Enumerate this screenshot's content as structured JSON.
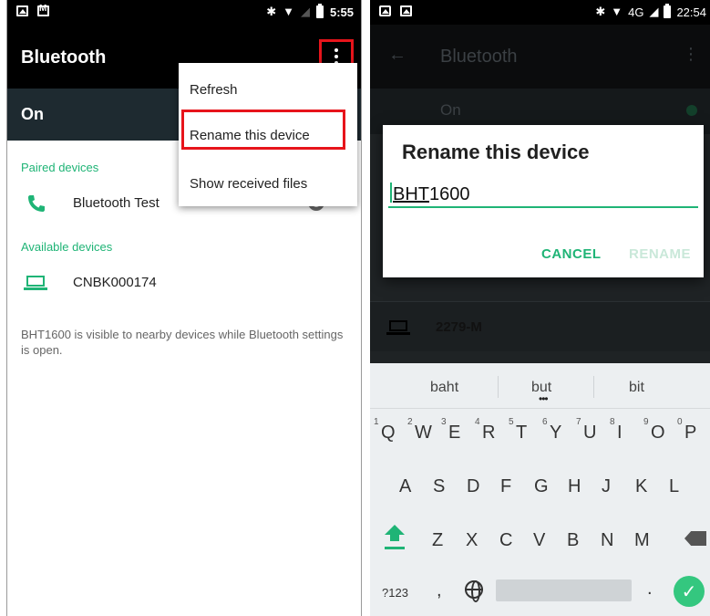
{
  "left_screen": {
    "status_bar": {
      "time": "5:55"
    },
    "app_bar": {
      "title": "Bluetooth"
    },
    "toggle_row": {
      "label": "On"
    },
    "paired": {
      "header": "Paired devices",
      "devices": [
        {
          "name": "Bluetooth Test"
        }
      ]
    },
    "available": {
      "header": "Available devices",
      "devices": [
        {
          "name": "CNBK000174"
        }
      ]
    },
    "visibility_note": "BHT1600 is visible to nearby devices while Bluetooth settings is open.",
    "overflow_menu": {
      "items": [
        {
          "label": "Refresh"
        },
        {
          "label": "Rename this device"
        },
        {
          "label": "Show received files"
        }
      ]
    }
  },
  "right_screen": {
    "status_bar": {
      "time": "22:54",
      "network": "4G"
    },
    "app_bar": {
      "title": "Bluetooth"
    },
    "toggle_row": {
      "label": "On"
    },
    "available_device": {
      "name": "2279-M"
    },
    "dialog": {
      "title": "Rename this device",
      "value_selected": "BHT",
      "value_rest": "1600",
      "cancel_label": "CANCEL",
      "rename_label": "RENAME"
    },
    "keyboard": {
      "suggestions": [
        "baht",
        "but",
        "bit"
      ],
      "row1": [
        "Q",
        "W",
        "E",
        "R",
        "T",
        "Y",
        "U",
        "I",
        "O",
        "P"
      ],
      "row1_hints": [
        "1",
        "2",
        "3",
        "4",
        "5",
        "6",
        "7",
        "8",
        "9",
        "0"
      ],
      "row2": [
        "A",
        "S",
        "D",
        "F",
        "G",
        "H",
        "J",
        "K",
        "L"
      ],
      "row3": [
        "Z",
        "X",
        "C",
        "V",
        "B",
        "N",
        "M"
      ],
      "symbols_key": "?123",
      "comma_key": ",",
      "period_key": "."
    }
  },
  "colors": {
    "accent": "#1fb476",
    "highlight_box": "#e7141b",
    "app_bar": "#000000",
    "on_bar": "#1e2a30"
  }
}
